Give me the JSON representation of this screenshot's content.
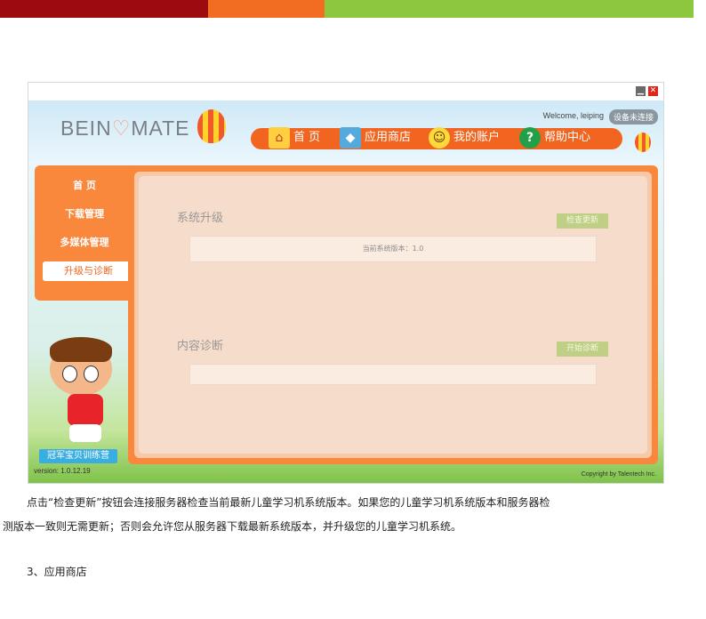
{
  "colors": {
    "bar_red": "#9e0b0f",
    "bar_orange": "#f26d21",
    "bar_green": "#8dc63f",
    "nav_orange": "#f26521"
  },
  "app": {
    "logo_prefix": "BEIN",
    "logo_suffix": "MATE",
    "welcome": "Welcome, leiping",
    "status_badge": "设备未连接",
    "nav": {
      "home": "首 页",
      "store": "应用商店",
      "account": "我的账户",
      "help": "帮助中心"
    },
    "sidebar": [
      "首 页",
      "下载管理",
      "多媒体管理",
      "升级与诊断"
    ],
    "upgrade": {
      "title": "系统升级",
      "button": "检查更新",
      "info": "当前系统版本：1.0"
    },
    "diagnose": {
      "title": "内容诊断",
      "button": "开始诊断",
      "info": ""
    },
    "camp_badge": "冠军宝贝训练营",
    "version": "version: 1.0.12.19",
    "copyright": "Copyright by Talentech Inc."
  },
  "doc": {
    "para_line1": "点击“检查更新”按钮会连接服务器检查当前最新儿童学习机系统版本。如果您的儿童学习机系统版本和服务器检",
    "para_line2": "测版本一致则无需更新；否则会允许您从服务器下载最新系统版本，并升级您的儿童学习机系统。",
    "heading": "3、应用商店"
  }
}
